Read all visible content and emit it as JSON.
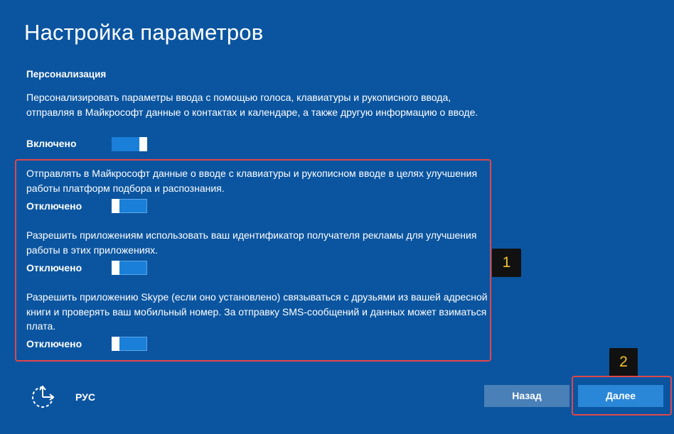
{
  "page": {
    "title": "Настройка параметров",
    "section_title": "Персонализация"
  },
  "main_setting": {
    "description": "Персонализировать параметры ввода с помощью голоса, клавиатуры и рукописного ввода, отправляя в Майкрософт данные о контактах и календаре, а также другую информацию о вводе.",
    "state_label": "Включено",
    "toggle_on": true
  },
  "settings": [
    {
      "description": "Отправлять в Майкрософт данные о вводе с клавиатуры и рукописном вводе в целях улучшения работы платформ подбора и распознания.",
      "state_label": "Отключено",
      "toggle_on": false
    },
    {
      "description": "Разрешить приложениям использовать ваш идентификатор получателя рекламы для улучшения работы в этих приложениях.",
      "state_label": "Отключено",
      "toggle_on": false
    },
    {
      "description": "Разрешить приложению Skype (если оно установлено) связываться с друзьями из вашей адресной книги и проверять ваш мобильный номер. За отправку SMS-сообщений и данных может взиматься плата.",
      "state_label": "Отключено",
      "toggle_on": false
    }
  ],
  "annotations": {
    "badge_1": "1",
    "badge_2": "2",
    "highlight_color": "#e0474a",
    "badge_text_color": "#f2c230"
  },
  "footer": {
    "accessibility_icon": "ease-of-access-icon",
    "language": "РУС",
    "back_label": "Назад",
    "next_label": "Далее"
  },
  "colors": {
    "background": "#0b55a0",
    "toggle_fill": "#1a7fd8",
    "back_button": "#4a80b8",
    "next_button": "#2a87d8"
  }
}
